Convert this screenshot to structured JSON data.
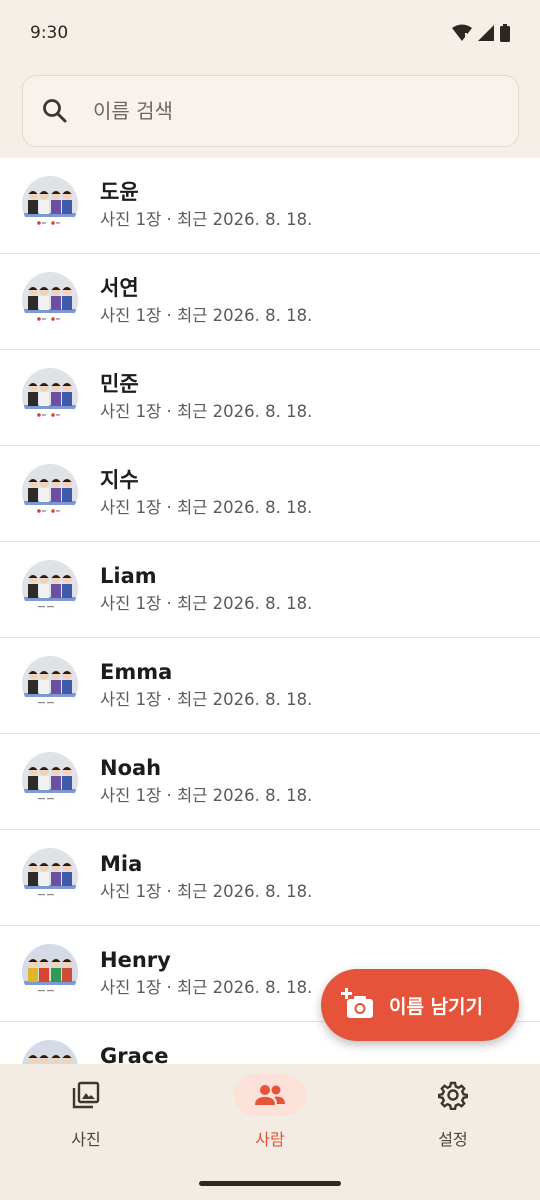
{
  "status_bar": {
    "time": "9:30"
  },
  "search": {
    "placeholder": "이름 검색",
    "value": ""
  },
  "people": [
    {
      "name": "도윤",
      "meta": "사진 1장 · 최근 2026. 8. 18.",
      "avatar": "group-red-labels"
    },
    {
      "name": "서연",
      "meta": "사진 1장 · 최근 2026. 8. 18.",
      "avatar": "group-red-labels"
    },
    {
      "name": "민준",
      "meta": "사진 1장 · 최근 2026. 8. 18.",
      "avatar": "group-red-labels"
    },
    {
      "name": "지수",
      "meta": "사진 1장 · 최근 2026. 8. 18.",
      "avatar": "group-red-labels"
    },
    {
      "name": "Liam",
      "meta": "사진 1장 · 최근 2026. 8. 18.",
      "avatar": "group-caption"
    },
    {
      "name": "Emma",
      "meta": "사진 1장 · 최근 2026. 8. 18.",
      "avatar": "group-caption"
    },
    {
      "name": "Noah",
      "meta": "사진 1장 · 최근 2026. 8. 18.",
      "avatar": "group-caption"
    },
    {
      "name": "Mia",
      "meta": "사진 1장 · 최근 2026. 8. 18.",
      "avatar": "group-caption"
    },
    {
      "name": "Henry",
      "meta": "사진 1장 · 최근 2026. 8. 18.",
      "avatar": "group-colorful"
    },
    {
      "name": "Grace",
      "meta": "",
      "avatar": "group-colorful"
    }
  ],
  "fab": {
    "label": "이름 남기기",
    "icon": "add-photo-icon"
  },
  "bottom_nav": {
    "items": [
      {
        "label": "사진",
        "icon": "photo-library-icon",
        "active": false
      },
      {
        "label": "사람",
        "icon": "people-icon",
        "active": true
      },
      {
        "label": "설정",
        "icon": "settings-icon",
        "active": false
      }
    ]
  },
  "colors": {
    "accent": "#e5533a",
    "background": "#f5efe7",
    "active_pill": "#fbe1d8",
    "list_background": "#ffffff"
  }
}
